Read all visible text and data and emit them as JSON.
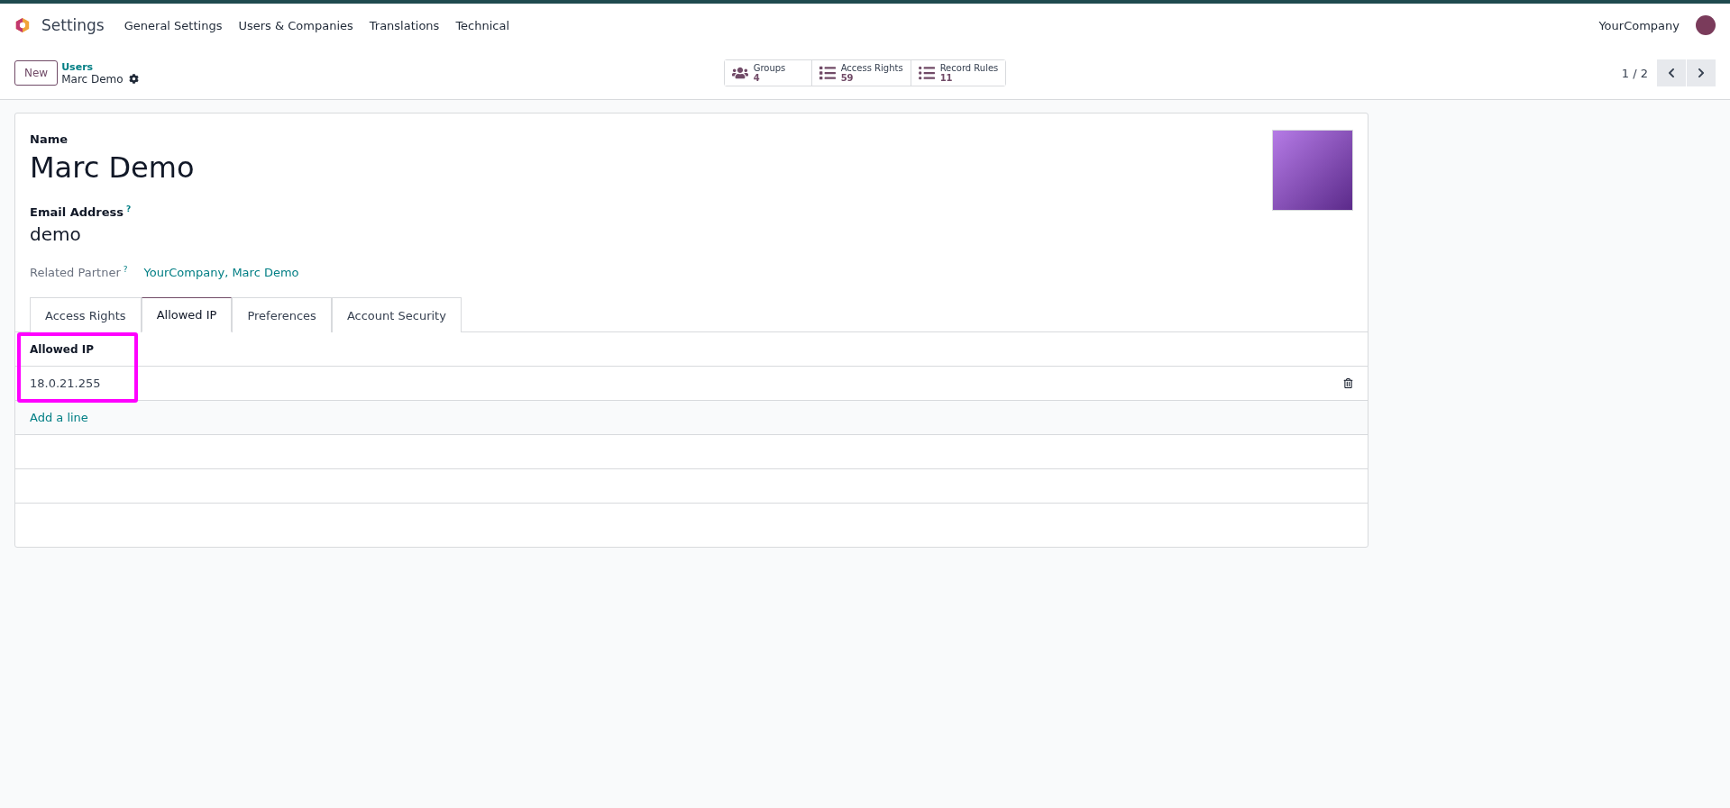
{
  "app": {
    "title": "Settings"
  },
  "menu": [
    "General Settings",
    "Users & Companies",
    "Translations",
    "Technical"
  ],
  "company": "YourCompany",
  "control_panel": {
    "new_button": "New",
    "breadcrumb": "Users",
    "record": "Marc Demo",
    "pager": "1 / 2"
  },
  "smart_buttons": [
    {
      "kind": "groups",
      "label": "Groups",
      "value": "4"
    },
    {
      "kind": "list",
      "label": "Access Rights",
      "value": "59"
    },
    {
      "kind": "rules",
      "label": "Record Rules",
      "value": "11"
    }
  ],
  "form": {
    "name_label": "Name",
    "name": "Marc Demo",
    "email_label": "Email Address",
    "help_mark": "?",
    "email": "demo",
    "partner_label": "Related Partner",
    "partner": "YourCompany, Marc Demo"
  },
  "tabs": [
    {
      "label": "Access Rights",
      "selected": false
    },
    {
      "label": "Allowed IP",
      "selected": true
    },
    {
      "label": "Preferences",
      "selected": false
    },
    {
      "label": "Account Security",
      "selected": false
    }
  ],
  "table": {
    "column": "Allowed IP",
    "rows": [
      "18.0.21.255"
    ],
    "add_line": "Add a line",
    "highlighted": true
  }
}
